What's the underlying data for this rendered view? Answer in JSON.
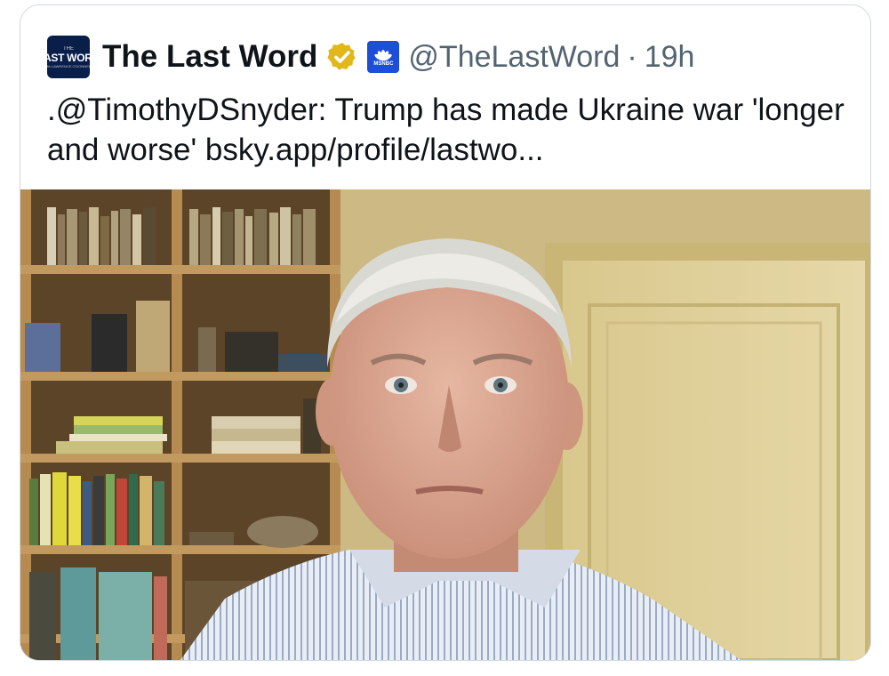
{
  "tweet": {
    "avatar": {
      "line1": "THE",
      "line2": "LAST WORD",
      "line3": "with LAWRENCE O'DONNELL"
    },
    "display_name": "The Last Word",
    "verified_badge": "gold-check-badge",
    "affiliate_badge": "msnbc-peacock-icon",
    "affiliate_label": "MSNBC",
    "handle": "@TheLastWord",
    "separator": "·",
    "time": "19h",
    "text": ".@TimothyDSnyder: Trump has made Ukraine war 'longer and worse' bsky.app/profile/lastwo..."
  },
  "colors": {
    "text": "#0f1419",
    "secondary": "#536471",
    "verified_gold": "#e2b719",
    "msnbc_blue": "#1d4ed8",
    "card_border": "#cfd9de"
  }
}
